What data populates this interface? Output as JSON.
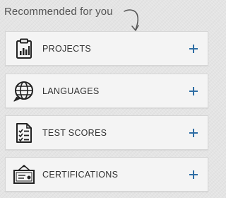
{
  "header": {
    "title": "Recommended for you",
    "arrow_icon": "curved-arrow-down-icon"
  },
  "cards": [
    {
      "label": "PROJECTS",
      "icon": "clipboard-chart-icon",
      "action_icon": "plus-icon"
    },
    {
      "label": "LANGUAGES",
      "icon": "globe-speech-icon",
      "action_icon": "plus-icon"
    },
    {
      "label": "TEST SCORES",
      "icon": "checklist-icon",
      "action_icon": "plus-icon"
    },
    {
      "label": "CERTIFICATIONS",
      "icon": "certificate-icon",
      "action_icon": "plus-icon"
    }
  ],
  "colors": {
    "accent": "#2e6da4",
    "text": "#333333",
    "background": "#e4e4e4",
    "card": "#f4f4f4"
  }
}
